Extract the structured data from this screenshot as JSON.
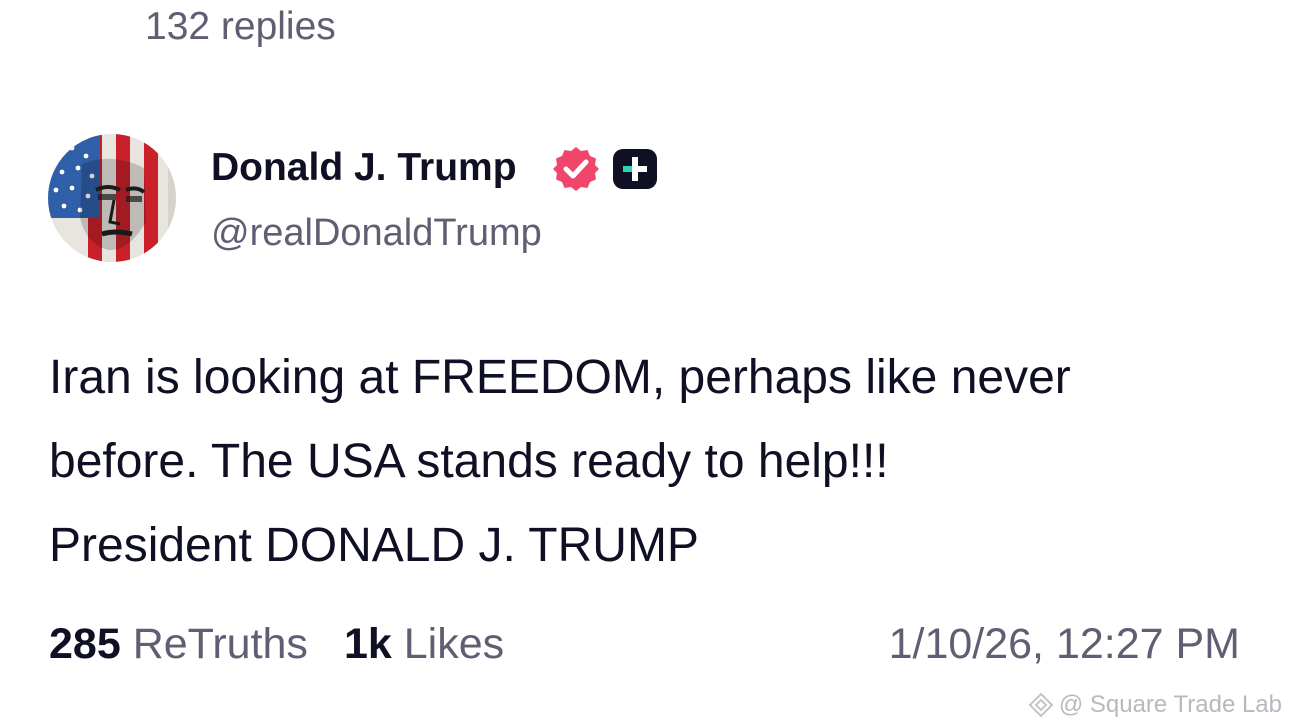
{
  "thread": {
    "replies_label": "132 replies"
  },
  "post": {
    "author": {
      "display_name": "Donald J. Trump",
      "handle": "@realDonaldTrump",
      "verified": true,
      "avatar_icon": "flag-face-avatar"
    },
    "body_lines": [
      "Iran is looking at FREEDOM, perhaps like never",
      "before. The USA stands ready to help!!!",
      "President DONALD J. TRUMP"
    ],
    "stats": {
      "retruths_count": "285",
      "retruths_label": "ReTruths",
      "likes_count": "1k",
      "likes_label": "Likes"
    },
    "timestamp": "1/10/26, 12:27 PM"
  },
  "watermark": {
    "text": "@ Square Trade Lab",
    "icon": "square-logo-icon"
  },
  "colors": {
    "text_primary": "#0f1024",
    "text_secondary": "#5e5f73",
    "verified_badge": "#f0466b",
    "plus_badge": "#0f1024",
    "plus_accent": "#28d6b4"
  }
}
